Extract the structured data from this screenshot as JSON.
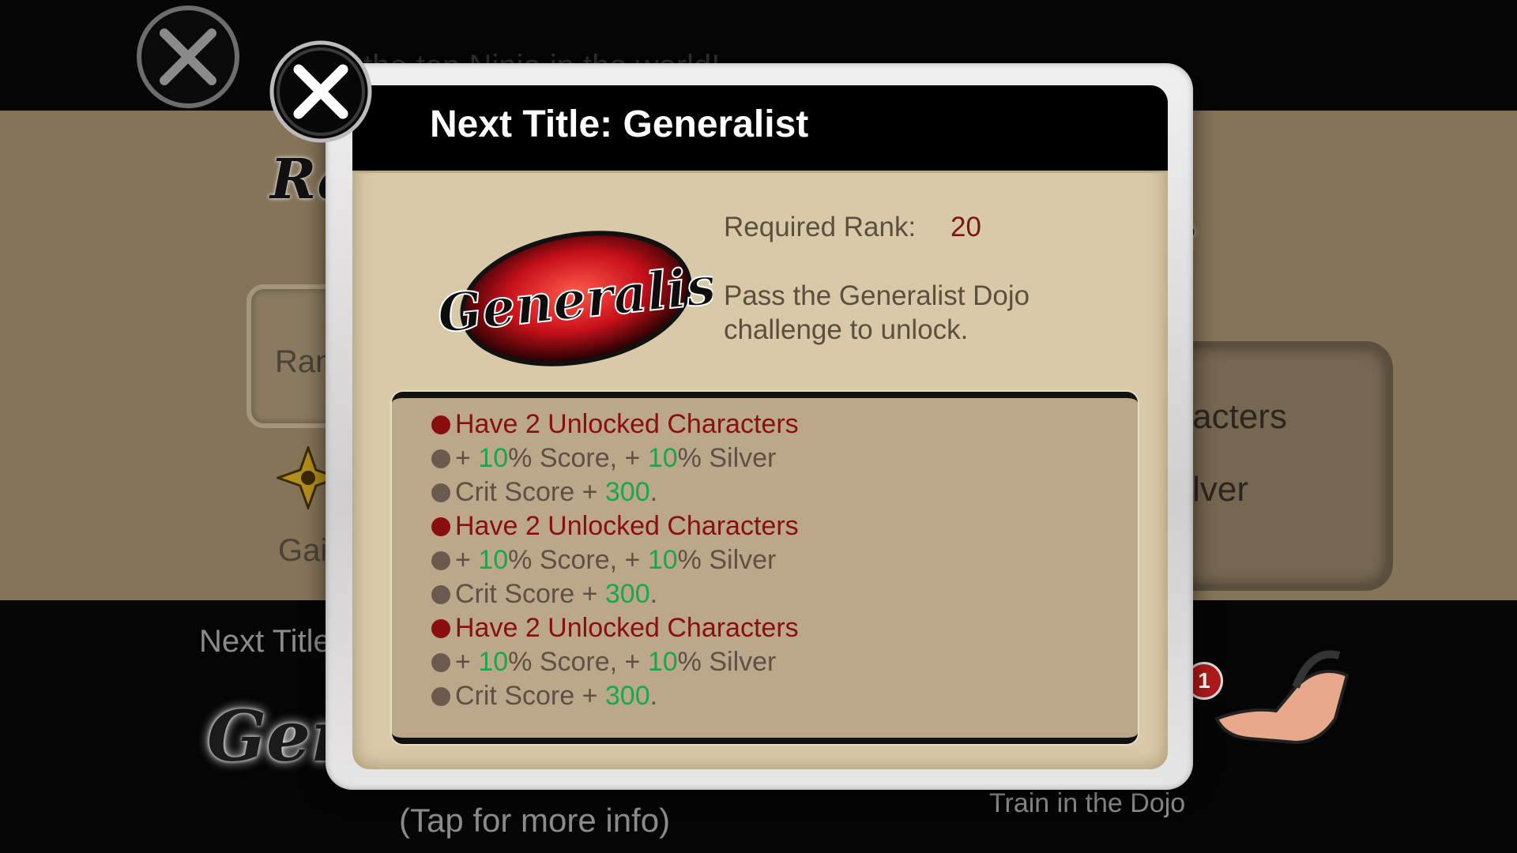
{
  "background": {
    "slogan": "the top Ninja in the world!",
    "rank_logo": "Ra",
    "rank_label": "Rank",
    "gain_label": "Gain",
    "characters_fragment": "aracters",
    "silver_fragment": "Silver",
    "right_logo_fragment": "e",
    "next_title_label": "Next Title:",
    "generalist_logo": "Gener",
    "tap_info": "(Tap for more info)",
    "train_dojo": "Train in the Dojo",
    "notification_badge": "1"
  },
  "modal": {
    "title": "Next Title: Generalist",
    "logo_text": "Generalist",
    "required_rank_label": "Required Rank:",
    "required_rank_value": "20",
    "unlock_description": "Pass the Generalist Dojo challenge to unlock.",
    "requirements": [
      {
        "condition": "Have 2 Unlocked Characters",
        "bonus": {
          "prefix_1": "+ ",
          "value_1": "10",
          "suffix_1": "% Score, + ",
          "value_2": "10",
          "suffix_2": "% Silver"
        },
        "crit": {
          "prefix": "Crit Score + ",
          "value": "300",
          "suffix": "."
        }
      },
      {
        "condition": "Have 2 Unlocked Characters",
        "bonus": {
          "prefix_1": "+ ",
          "value_1": "10",
          "suffix_1": "% Score, + ",
          "value_2": "10",
          "suffix_2": "% Silver"
        },
        "crit": {
          "prefix": "Crit Score + ",
          "value": "300",
          "suffix": "."
        }
      },
      {
        "condition": "Have 2 Unlocked Characters",
        "bonus": {
          "prefix_1": "+ ",
          "value_1": "10",
          "suffix_1": "% Score, + ",
          "value_2": "10",
          "suffix_2": "% Silver"
        },
        "crit": {
          "prefix": "Crit Score + ",
          "value": "300",
          "suffix": "."
        }
      }
    ]
  },
  "icons": {
    "modal_close": "close-x-icon",
    "background_close": "close-x-icon",
    "shuriken": "shuriken-icon",
    "pointing_hand": "pointing-hand-icon"
  },
  "colors": {
    "condition_red": "#8b0e0e",
    "bonus_value_green": "#17a84a",
    "panel_tan": "#d8caa8",
    "rank_value_red": "#7d1414"
  }
}
